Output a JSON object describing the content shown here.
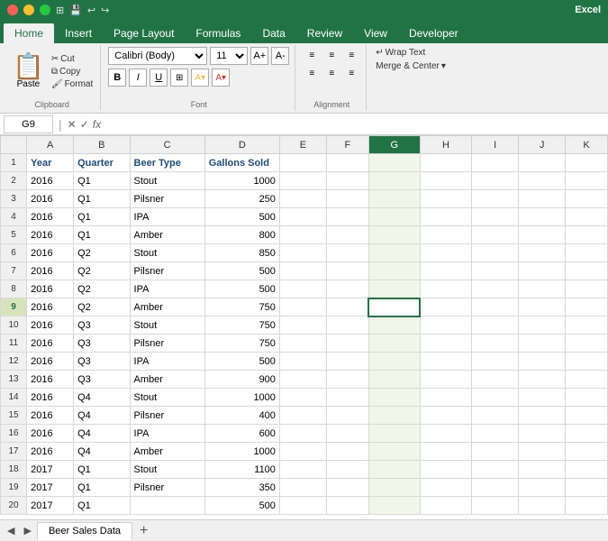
{
  "titleBar": {
    "appName": "Excel",
    "windowBtns": [
      "close",
      "minimize",
      "maximize"
    ]
  },
  "ribbonTabs": [
    "Home",
    "Insert",
    "Page Layout",
    "Formulas",
    "Data",
    "Review",
    "View",
    "Developer"
  ],
  "activeTab": "Home",
  "clipboard": {
    "paste": "Paste",
    "cut": "Cut",
    "copy": "Copy",
    "format": "Format"
  },
  "font": {
    "name": "Calibri (Body)",
    "size": "11",
    "bold": "B",
    "italic": "I",
    "underline": "U"
  },
  "formulaBar": {
    "cellRef": "G9",
    "formula": ""
  },
  "columns": [
    "",
    "A",
    "B",
    "C",
    "D",
    "E",
    "F",
    "G",
    "H",
    "I",
    "J",
    "K"
  ],
  "rows": [
    {
      "num": 1,
      "cells": [
        "Year",
        "Quarter",
        "Beer Type",
        "Gallons Sold",
        "",
        "",
        "",
        "",
        "",
        "",
        ""
      ],
      "header": true
    },
    {
      "num": 2,
      "cells": [
        "2016",
        "Q1",
        "Stout",
        "1000",
        "",
        "",
        "",
        "",
        "",
        "",
        ""
      ]
    },
    {
      "num": 3,
      "cells": [
        "2016",
        "Q1",
        "Pilsner",
        "250",
        "",
        "",
        "",
        "",
        "",
        "",
        ""
      ]
    },
    {
      "num": 4,
      "cells": [
        "2016",
        "Q1",
        "IPA",
        "500",
        "",
        "",
        "",
        "",
        "",
        "",
        ""
      ]
    },
    {
      "num": 5,
      "cells": [
        "2016",
        "Q1",
        "Amber",
        "800",
        "",
        "",
        "",
        "",
        "",
        "",
        ""
      ]
    },
    {
      "num": 6,
      "cells": [
        "2016",
        "Q2",
        "Stout",
        "850",
        "",
        "",
        "",
        "",
        "",
        "",
        ""
      ]
    },
    {
      "num": 7,
      "cells": [
        "2016",
        "Q2",
        "Pilsner",
        "500",
        "",
        "",
        "",
        "",
        "",
        "",
        ""
      ]
    },
    {
      "num": 8,
      "cells": [
        "2016",
        "Q2",
        "IPA",
        "500",
        "",
        "",
        "",
        "",
        "",
        "",
        ""
      ]
    },
    {
      "num": 9,
      "cells": [
        "2016",
        "Q2",
        "Amber",
        "750",
        "",
        "",
        "",
        "",
        "",
        "",
        ""
      ],
      "selected": true
    },
    {
      "num": 10,
      "cells": [
        "2016",
        "Q3",
        "Stout",
        "750",
        "",
        "",
        "",
        "",
        "",
        "",
        ""
      ]
    },
    {
      "num": 11,
      "cells": [
        "2016",
        "Q3",
        "Pilsner",
        "750",
        "",
        "",
        "",
        "",
        "",
        "",
        ""
      ]
    },
    {
      "num": 12,
      "cells": [
        "2016",
        "Q3",
        "IPA",
        "500",
        "",
        "",
        "",
        "",
        "",
        "",
        ""
      ]
    },
    {
      "num": 13,
      "cells": [
        "2016",
        "Q3",
        "Amber",
        "900",
        "",
        "",
        "",
        "",
        "",
        "",
        ""
      ]
    },
    {
      "num": 14,
      "cells": [
        "2016",
        "Q4",
        "Stout",
        "1000",
        "",
        "",
        "",
        "",
        "",
        "",
        ""
      ]
    },
    {
      "num": 15,
      "cells": [
        "2016",
        "Q4",
        "Pilsner",
        "400",
        "",
        "",
        "",
        "",
        "",
        "",
        ""
      ]
    },
    {
      "num": 16,
      "cells": [
        "2016",
        "Q4",
        "IPA",
        "600",
        "",
        "",
        "",
        "",
        "",
        "",
        ""
      ]
    },
    {
      "num": 17,
      "cells": [
        "2016",
        "Q4",
        "Amber",
        "1000",
        "",
        "",
        "",
        "",
        "",
        "",
        ""
      ]
    },
    {
      "num": 18,
      "cells": [
        "2017",
        "Q1",
        "Stout",
        "1100",
        "",
        "",
        "",
        "",
        "",
        "",
        ""
      ]
    },
    {
      "num": 19,
      "cells": [
        "2017",
        "Q1",
        "Pilsner",
        "350",
        "",
        "",
        "",
        "",
        "",
        "",
        ""
      ]
    },
    {
      "num": 20,
      "cells": [
        "2017",
        "Q1",
        "",
        "500",
        "",
        "",
        "",
        "",
        "",
        "",
        ""
      ]
    }
  ],
  "sheetTab": "Beer Sales Data",
  "addSheetLabel": "+",
  "colors": {
    "headerGreen": "#217346",
    "tabActive": "#1aad6f",
    "selectedCol": "#d6e4bc",
    "selectedColHeader": "#217346"
  }
}
